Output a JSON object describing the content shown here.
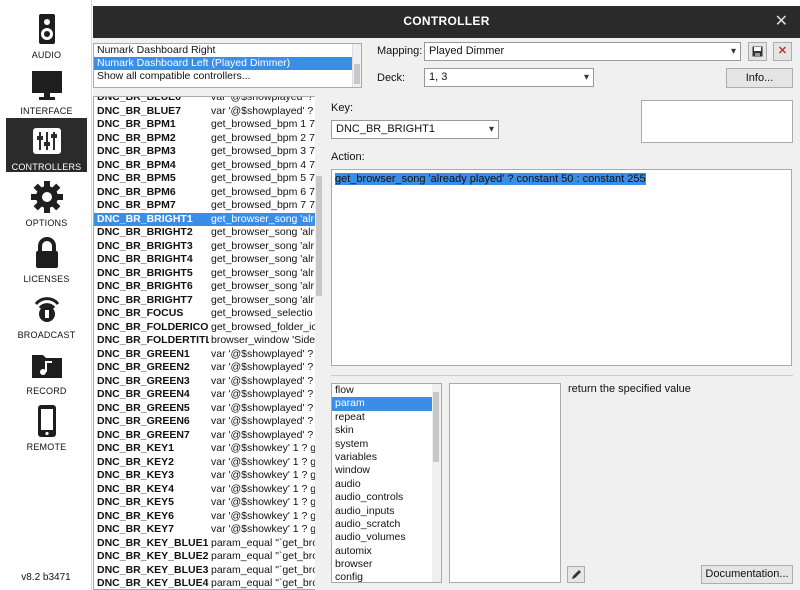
{
  "sidebar": {
    "items": [
      {
        "label": "AUDIO",
        "icon": "speaker-icon"
      },
      {
        "label": "INTERFACE",
        "icon": "monitor-icon"
      },
      {
        "label": "CONTROLLERS",
        "icon": "sliders-icon"
      },
      {
        "label": "OPTIONS",
        "icon": "gear-icon"
      },
      {
        "label": "LICENSES",
        "icon": "lock-icon"
      },
      {
        "label": "BROADCAST",
        "icon": "broadcast-icon"
      },
      {
        "label": "RECORD",
        "icon": "music-folder-icon"
      },
      {
        "label": "REMOTE",
        "icon": "phone-icon"
      }
    ],
    "active": "CONTROLLERS",
    "version": "v8.2 b3471"
  },
  "titlebar": {
    "title": "CONTROLLER",
    "close": "✕"
  },
  "controllers": {
    "items": [
      "Numark Dashboard Right",
      "Numark Dashboard Left (Played Dimmer)",
      "Show all compatible controllers..."
    ],
    "selected_index": 1
  },
  "mapping": {
    "label": "Mapping:",
    "value": "Played Dimmer",
    "save_icon": "save-icon",
    "delete_icon": "delete-icon"
  },
  "deck": {
    "label": "Deck:",
    "value": "1, 3"
  },
  "info_button": "Info...",
  "key": {
    "label": "Key:",
    "value": "DNC_BR_BRIGHT1"
  },
  "action": {
    "label": "Action:",
    "value": "get_browser_song 'already played' ? constant 50 : constant 255"
  },
  "key_value_rows": [
    {
      "k": "DNC_BR_BLUE6",
      "v": "var '@$showplayed' ?"
    },
    {
      "k": "DNC_BR_BLUE7",
      "v": "var '@$showplayed' ?"
    },
    {
      "k": "DNC_BR_BPM1",
      "v": "get_browsed_bpm 1 7"
    },
    {
      "k": "DNC_BR_BPM2",
      "v": "get_browsed_bpm 2 7"
    },
    {
      "k": "DNC_BR_BPM3",
      "v": "get_browsed_bpm 3 7"
    },
    {
      "k": "DNC_BR_BPM4",
      "v": "get_browsed_bpm 4 7"
    },
    {
      "k": "DNC_BR_BPM5",
      "v": "get_browsed_bpm 5 7"
    },
    {
      "k": "DNC_BR_BPM6",
      "v": "get_browsed_bpm 6 7"
    },
    {
      "k": "DNC_BR_BPM7",
      "v": "get_browsed_bpm 7 7"
    },
    {
      "k": "DNC_BR_BRIGHT1",
      "v": "get_browser_song 'alr"
    },
    {
      "k": "DNC_BR_BRIGHT2",
      "v": "get_browser_song 'alr"
    },
    {
      "k": "DNC_BR_BRIGHT3",
      "v": "get_browser_song 'alr"
    },
    {
      "k": "DNC_BR_BRIGHT4",
      "v": "get_browser_song 'alr"
    },
    {
      "k": "DNC_BR_BRIGHT5",
      "v": "get_browser_song 'alr"
    },
    {
      "k": "DNC_BR_BRIGHT6",
      "v": "get_browser_song 'alr"
    },
    {
      "k": "DNC_BR_BRIGHT7",
      "v": "get_browser_song 'alr"
    },
    {
      "k": "DNC_BR_FOCUS",
      "v": "get_browsed_selectio"
    },
    {
      "k": "DNC_BR_FOLDERICON",
      "v": "get_browsed_folder_ic"
    },
    {
      "k": "DNC_BR_FOLDERTITLE",
      "v": "browser_window 'Side"
    },
    {
      "k": "DNC_BR_GREEN1",
      "v": "var '@$showplayed' ?"
    },
    {
      "k": "DNC_BR_GREEN2",
      "v": "var '@$showplayed' ?"
    },
    {
      "k": "DNC_BR_GREEN3",
      "v": "var '@$showplayed' ?"
    },
    {
      "k": "DNC_BR_GREEN4",
      "v": "var '@$showplayed' ?"
    },
    {
      "k": "DNC_BR_GREEN5",
      "v": "var '@$showplayed' ?"
    },
    {
      "k": "DNC_BR_GREEN6",
      "v": "var '@$showplayed' ?"
    },
    {
      "k": "DNC_BR_GREEN7",
      "v": "var '@$showplayed' ?"
    },
    {
      "k": "DNC_BR_KEY1",
      "v": "var '@$showkey' 1 ? ge"
    },
    {
      "k": "DNC_BR_KEY2",
      "v": "var '@$showkey' 1 ? ge"
    },
    {
      "k": "DNC_BR_KEY3",
      "v": "var '@$showkey' 1 ? ge"
    },
    {
      "k": "DNC_BR_KEY4",
      "v": "var '@$showkey' 1 ? ge"
    },
    {
      "k": "DNC_BR_KEY5",
      "v": "var '@$showkey' 1 ? ge"
    },
    {
      "k": "DNC_BR_KEY6",
      "v": "var '@$showkey' 1 ? ge"
    },
    {
      "k": "DNC_BR_KEY7",
      "v": "var '@$showkey' 1 ? ge"
    },
    {
      "k": "DNC_BR_KEY_BLUE1",
      "v": "param_equal \"`get_bro"
    },
    {
      "k": "DNC_BR_KEY_BLUE2",
      "v": "param_equal \"`get_bro"
    },
    {
      "k": "DNC_BR_KEY_BLUE3",
      "v": "param_equal \"`get_bro"
    },
    {
      "k": "DNC_BR_KEY_BLUE4",
      "v": "param_equal \"`get_bro"
    }
  ],
  "selected_key_index": 9,
  "categories": [
    "flow",
    "param",
    "repeat",
    "skin",
    "system",
    "variables",
    "window",
    "audio",
    "audio_controls",
    "audio_inputs",
    "audio_scratch",
    "audio_volumes",
    "automix",
    "browser",
    "config"
  ],
  "selected_category_index": 1,
  "function_description": "return the specified value",
  "documentation_button": "Documentation...",
  "pencil_icon": "pencil-icon",
  "accent_color": "#3a8ee6"
}
